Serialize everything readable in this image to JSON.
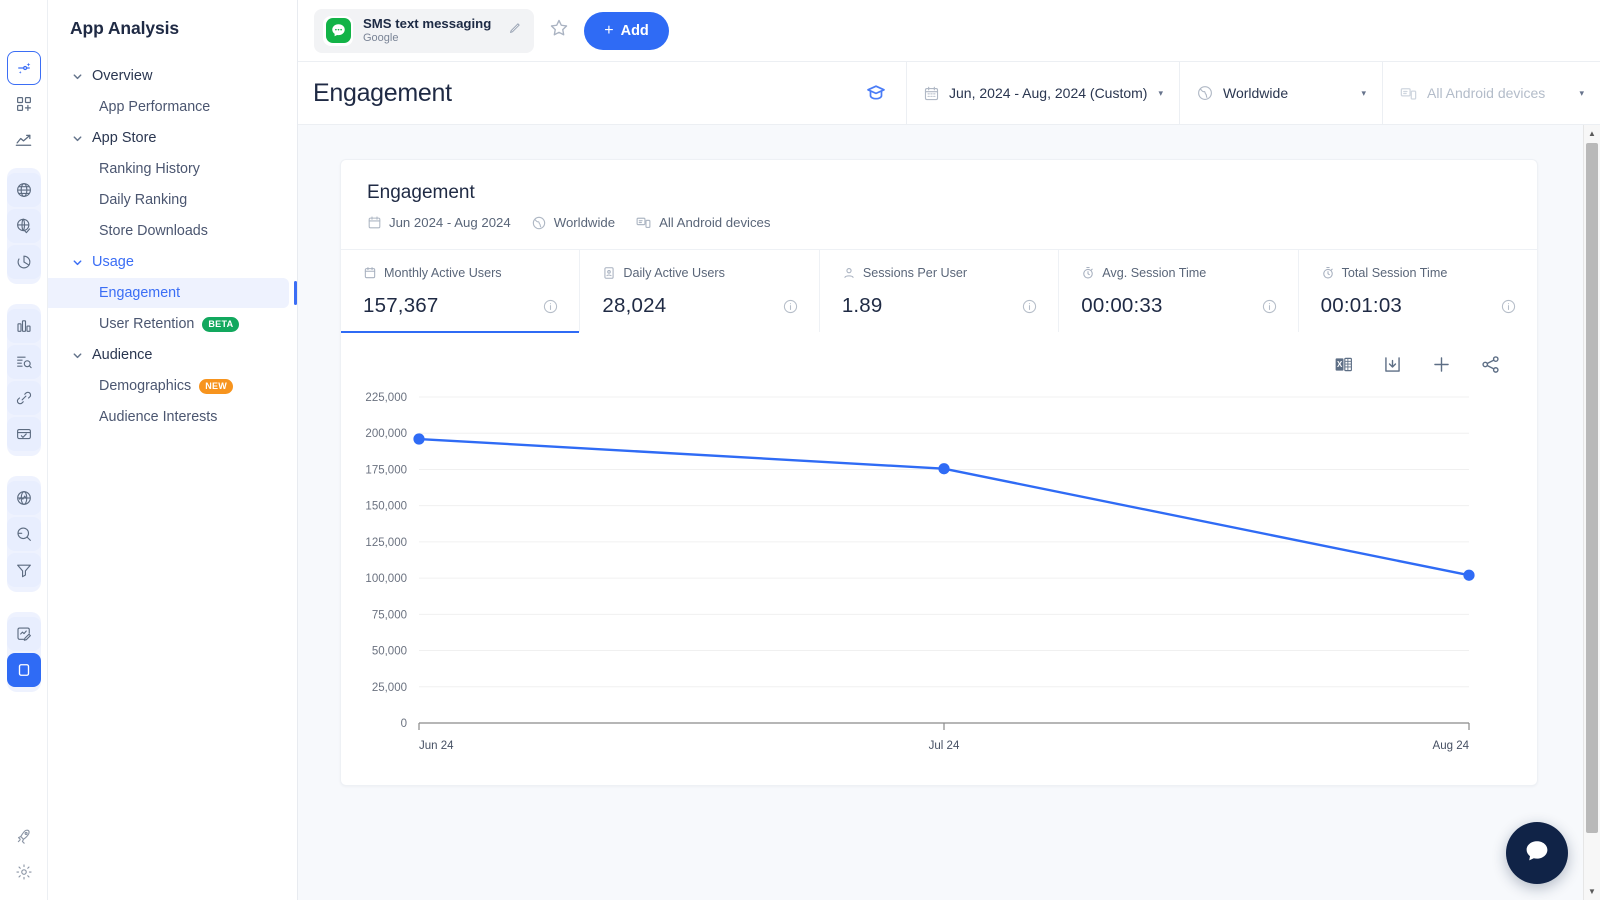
{
  "rail": {
    "logo": "sensortower-logo",
    "items": [
      {
        "name": "ai-insights",
        "icon": "sparkle-icon"
      },
      {
        "name": "apps-add",
        "icon": "apps-plus-icon"
      },
      {
        "name": "trends",
        "icon": "line-chart-icon"
      },
      {
        "name": "store-intelligence",
        "icon": "globe-icon"
      },
      {
        "name": "market-intelligence",
        "icon": "globe-check-icon"
      },
      {
        "name": "usage-intelligence",
        "icon": "pie-chart-icon"
      },
      {
        "name": "ad-intelligence",
        "icon": "bar-chart-icon"
      },
      {
        "name": "creative-gallery",
        "icon": "doc-search-icon"
      },
      {
        "name": "attribution",
        "icon": "link-icon"
      },
      {
        "name": "reports",
        "icon": "card-check-icon"
      },
      {
        "name": "explorer",
        "icon": "globe-pulse-icon"
      },
      {
        "name": "search",
        "icon": "magnifier-icon"
      },
      {
        "name": "filters",
        "icon": "funnel-icon"
      },
      {
        "name": "my-reports",
        "icon": "report-pen-icon"
      },
      {
        "name": "app-analysis",
        "icon": "mobile-icon"
      },
      {
        "name": "whats-new",
        "icon": "rocket-icon"
      },
      {
        "name": "settings",
        "icon": "gear-icon"
      }
    ]
  },
  "sidebar": {
    "title": "App Analysis",
    "groups": [
      {
        "label": "Overview",
        "selected": false,
        "items": [
          {
            "label": "App Performance",
            "active": false,
            "badge": null
          }
        ]
      },
      {
        "label": "App Store",
        "selected": false,
        "items": [
          {
            "label": "Ranking History",
            "active": false,
            "badge": null
          },
          {
            "label": "Daily Ranking",
            "active": false,
            "badge": null
          },
          {
            "label": "Store Downloads",
            "active": false,
            "badge": null
          }
        ]
      },
      {
        "label": "Usage",
        "selected": true,
        "items": [
          {
            "label": "Engagement",
            "active": true,
            "badge": null
          },
          {
            "label": "User Retention",
            "active": false,
            "badge": "BETA",
            "badge_kind": "beta"
          }
        ]
      },
      {
        "label": "Audience",
        "selected": false,
        "items": [
          {
            "label": "Demographics",
            "active": false,
            "badge": "NEW",
            "badge_kind": "new"
          },
          {
            "label": "Audience Interests",
            "active": false,
            "badge": null
          }
        ]
      }
    ]
  },
  "topbar": {
    "app_name": "SMS text messaging",
    "app_developer": "Google",
    "app_icon": "green-message-bubble-icon",
    "edit_icon": "pencil-icon",
    "favorite_icon": "star-icon",
    "add_label": "Add",
    "add_plus": "+"
  },
  "pagebar": {
    "title": "Engagement",
    "academy_icon": "graduation-cap-icon",
    "date_filter": "Jun, 2024 - Aug, 2024 (Custom)",
    "date_icon": "calendar-icon",
    "geo_filter": "Worldwide",
    "geo_icon": "globe-icon",
    "device_filter": "All Android devices",
    "device_icon": "devices-icon",
    "caret": "▾"
  },
  "card": {
    "title": "Engagement",
    "sub_date": "Jun 2024 - Aug 2024",
    "sub_geo": "Worldwide",
    "sub_device": "All Android devices",
    "metrics": [
      {
        "label": "Monthly Active Users",
        "value": "157,367",
        "icon": "calendar-month-icon",
        "active": true
      },
      {
        "label": "Daily Active Users",
        "value": "28,024",
        "icon": "id-card-icon",
        "active": false
      },
      {
        "label": "Sessions Per User",
        "value": "1.89",
        "icon": "person-icon",
        "active": false
      },
      {
        "label": "Avg. Session Time",
        "value": "00:00:33",
        "icon": "stopwatch-icon",
        "active": false
      },
      {
        "label": "Total Session Time",
        "value": "00:01:03",
        "icon": "stopwatch-icon",
        "active": false
      }
    ],
    "tools": [
      {
        "name": "export-excel-icon",
        "label": "Excel"
      },
      {
        "name": "download-icon",
        "label": "Download"
      },
      {
        "name": "add-icon",
        "label": "Add"
      },
      {
        "name": "share-icon",
        "label": "Share"
      }
    ]
  },
  "chart_data": {
    "type": "line",
    "title": "Engagement",
    "series": [
      {
        "name": "Monthly Active Users",
        "values": [
          196000,
          175500,
          102000
        ],
        "color": "#2f6bf5"
      }
    ],
    "categories": [
      "Jun 24",
      "Jul 24",
      "Aug 24"
    ],
    "x": [
      "Jun 24",
      "Jul 24",
      "Aug 24"
    ],
    "xlabel": "",
    "ylabel": "",
    "ylim": [
      0,
      225000
    ],
    "ytick_labels": [
      "225,000",
      "200,000",
      "175,000",
      "150,000",
      "125,000",
      "100,000",
      "75,000",
      "50,000",
      "25,000",
      "0"
    ],
    "ytick_values": [
      225000,
      200000,
      175000,
      150000,
      125000,
      100000,
      75000,
      50000,
      25000,
      0
    ],
    "grid": true,
    "legend": "none",
    "marker": "circle"
  },
  "fab": {
    "icon": "chat-bubble-icon"
  },
  "colors": {
    "accent": "#2f6bf5",
    "line": "#2f6bf5",
    "beta_badge": "#12a85e",
    "new_badge": "#f7941e",
    "app_icon_green": "#12b347",
    "fab": "#102347",
    "content_bg": "#f7f9fc"
  }
}
